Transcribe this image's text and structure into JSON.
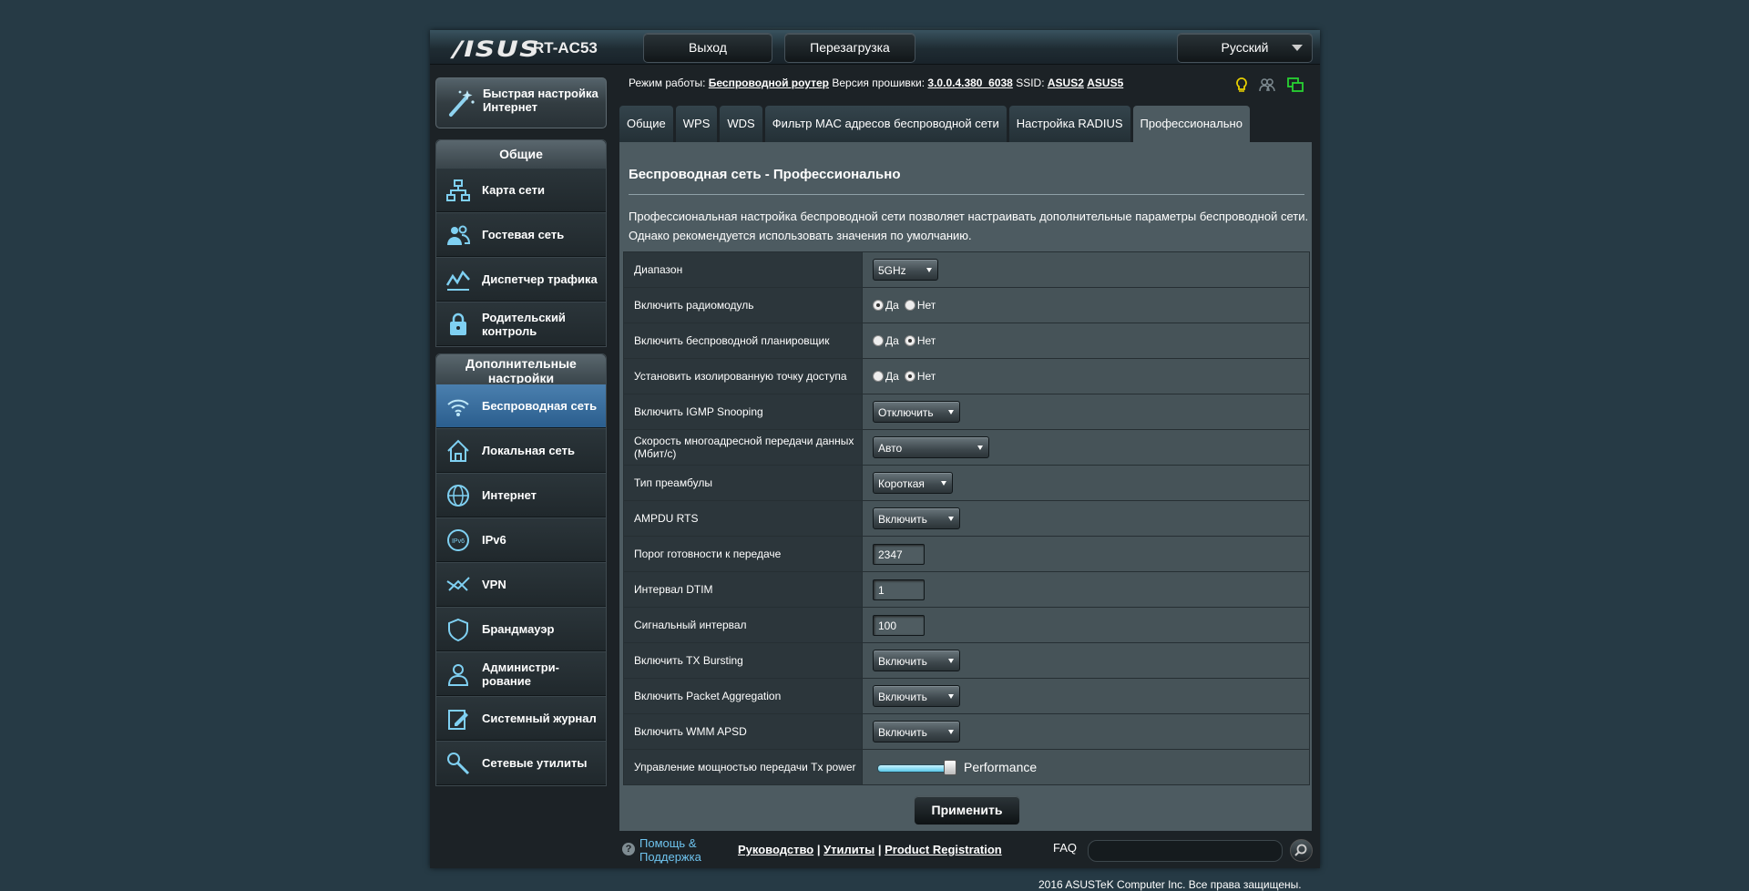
{
  "header": {
    "brand": "/ISUS",
    "model": "RT-AC53",
    "logout_label": "Выход",
    "reboot_label": "Перезагрузка",
    "language": "Русский"
  },
  "sidebar": {
    "quick_setup_label": "Быстрая настройка Интернет",
    "general_title": "Общие",
    "general_items": [
      {
        "label": "Карта сети",
        "icon": "network-map-icon"
      },
      {
        "label": "Гостевая сеть",
        "icon": "guest-network-icon"
      },
      {
        "label": "Диспетчер трафика",
        "icon": "traffic-manager-icon"
      },
      {
        "label": "Родительский контроль",
        "icon": "parental-control-icon"
      }
    ],
    "advanced_title": "Дополнительные настройки",
    "advanced_items": [
      {
        "label": "Беспроводная сеть",
        "icon": "wifi-icon",
        "active": true
      },
      {
        "label": "Локальная сеть",
        "icon": "home-icon"
      },
      {
        "label": "Интернет",
        "icon": "globe-icon"
      },
      {
        "label": "IPv6",
        "icon": "ipv6-icon"
      },
      {
        "label": "VPN",
        "icon": "vpn-icon"
      },
      {
        "label": "Брандмауэр",
        "icon": "shield-icon"
      },
      {
        "label": "Администри-рование",
        "icon": "admin-user-icon"
      },
      {
        "label": "Системный журнал",
        "icon": "log-icon"
      },
      {
        "label": "Сетевые утилиты",
        "icon": "tools-icon"
      }
    ]
  },
  "status": {
    "mode_label": "Режим работы:",
    "mode_value": "Беспроводной роутер",
    "firmware_label": "Версия прошивки:",
    "firmware_value": "3.0.0.4.380_6038",
    "ssid_label": "SSID:",
    "ssid_1": "ASUS2",
    "ssid_2": "ASUS5"
  },
  "tabs": [
    "Общие",
    "WPS",
    "WDS",
    "Фильтр MAC адресов беспроводной сети",
    "Настройка RADIUS",
    "Профессионально"
  ],
  "page": {
    "title": "Беспроводная сеть - Профессионально",
    "description": "Профессиональная настройка беспроводной сети позволяет настраивать дополнительные параметры беспроводной сети. Однако рекомендуется использовать значения по умолчанию."
  },
  "settings": {
    "band": {
      "label": "Диапазон",
      "value": "5GHz"
    },
    "radio": {
      "label": "Включить радиомодуль",
      "yes": "Да",
      "no": "Нет",
      "selected": "yes"
    },
    "scheduler": {
      "label": "Включить беспроводной планировщик",
      "yes": "Да",
      "no": "Нет",
      "selected": "no"
    },
    "isolate": {
      "label": "Установить изолированную точку доступа",
      "yes": "Да",
      "no": "Нет",
      "selected": "no"
    },
    "igmp": {
      "label": "Включить IGMP Snooping",
      "value": "Отключить"
    },
    "multicast": {
      "label": "Скорость многоадресной передачи данных (Мбит/с)",
      "value": "Авто"
    },
    "preamble": {
      "label": "Тип преамбулы",
      "value": "Короткая"
    },
    "ampdu": {
      "label": "AMPDU RTS",
      "value": "Включить"
    },
    "rts": {
      "label": "Порог готовности к передаче",
      "value": "2347"
    },
    "dtim": {
      "label": "Интервал DTIM",
      "value": "1"
    },
    "beacon": {
      "label": "Сигнальный интервал",
      "value": "100"
    },
    "txburst": {
      "label": "Включить TX Bursting",
      "value": "Включить"
    },
    "pktagg": {
      "label": "Включить Packet Aggregation",
      "value": "Включить"
    },
    "wmm": {
      "label": "Включить WMM APSD",
      "value": "Включить"
    },
    "txpower": {
      "label": "Управление мощностью передачи Tx power",
      "value_text": "Performance",
      "level": 1.0
    }
  },
  "apply_label": "Применить",
  "footer": {
    "help_label": "Помощь & Поддержка",
    "link_manual": "Руководство",
    "link_utils": "Утилиты",
    "link_registration": "Product Registration",
    "faq_label": "FAQ",
    "copyright": "2016 ASUSTeK Computer Inc. Все права защищены."
  },
  "colors": {
    "background": "#263a45",
    "active_nav": "#3d74a5",
    "content": "#4d5b61",
    "help_link": "#6ec3ee"
  }
}
